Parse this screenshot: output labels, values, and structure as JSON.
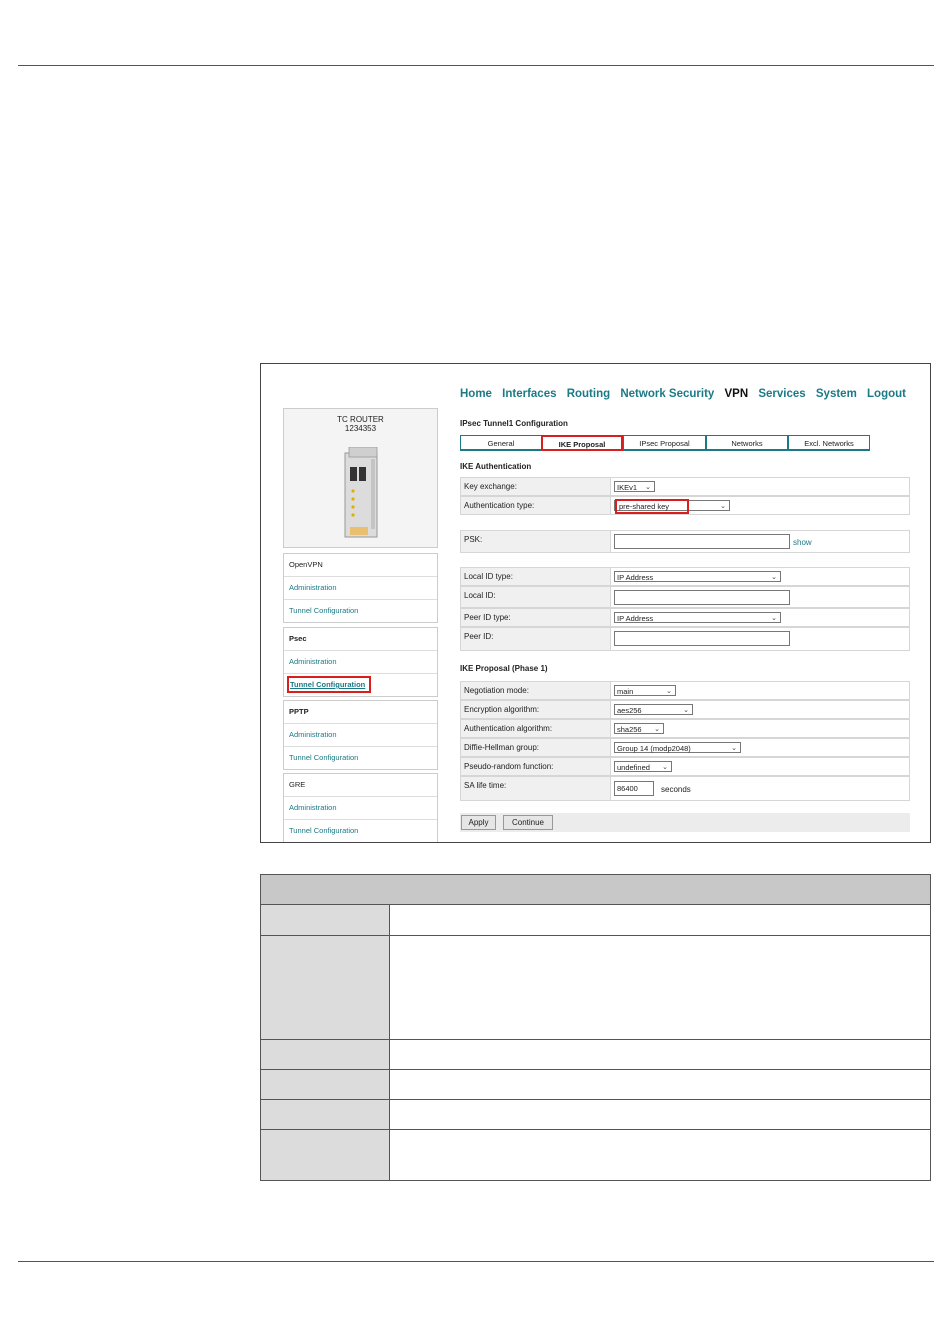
{
  "nav": {
    "items": [
      "Home",
      "Interfaces",
      "Routing",
      "Network Security",
      "VPN",
      "Services",
      "System",
      "Logout"
    ],
    "active": "VPN"
  },
  "product": {
    "name": "TC ROUTER",
    "number": "1234353"
  },
  "sidebar": {
    "groups": [
      {
        "title": "OpenVPN",
        "items": [
          "Administration",
          "Tunnel Configuration"
        ]
      },
      {
        "title": "Psec",
        "items": [
          "Administration",
          "Tunnel Configuration"
        ]
      },
      {
        "title": "PPTP",
        "items": [
          "Administration",
          "Tunnel Configuration"
        ]
      },
      {
        "title": "GRE",
        "items": [
          "Administration",
          "Tunnel Configuration"
        ]
      }
    ]
  },
  "config": {
    "title": "IPsec Tunnel1 Configuration",
    "tabs": [
      "General",
      "IKE Proposal",
      "IPsec Proposal",
      "Networks",
      "Excl. Networks"
    ],
    "ike_auth_title": "IKE Authentication",
    "key_exchange": {
      "label": "Key exchange:",
      "value": "IKEv1"
    },
    "auth_type": {
      "label": "Authentication type:",
      "value": "pre-shared key"
    },
    "psk": {
      "label": "PSK:",
      "value": "",
      "show": "show"
    },
    "local_id_type": {
      "label": "Local ID type:",
      "value": "IP Address"
    },
    "local_id": {
      "label": "Local ID:",
      "value": ""
    },
    "peer_id_type": {
      "label": "Peer ID type:",
      "value": "IP Address"
    },
    "peer_id": {
      "label": "Peer ID:",
      "value": ""
    },
    "phase1_title": "IKE Proposal (Phase 1)",
    "negotiation_mode": {
      "label": "Negotiation mode:",
      "value": "main"
    },
    "encryption": {
      "label": "Encryption algorithm:",
      "value": "aes256"
    },
    "auth_alg": {
      "label": "Authentication algorithm:",
      "value": "sha256"
    },
    "dh_group": {
      "label": "Diffie-Hellman group:",
      "value": "Group 14 (modp2048)"
    },
    "prf": {
      "label": "Pseudo-random function:",
      "value": "undefined"
    },
    "sa_life": {
      "label": "SA life time:",
      "value": "86400",
      "unit": "seconds"
    },
    "buttons": {
      "apply": "Apply",
      "continue": "Continue"
    }
  },
  "accent": "#1b7a86",
  "highlight": "#d91e1e"
}
